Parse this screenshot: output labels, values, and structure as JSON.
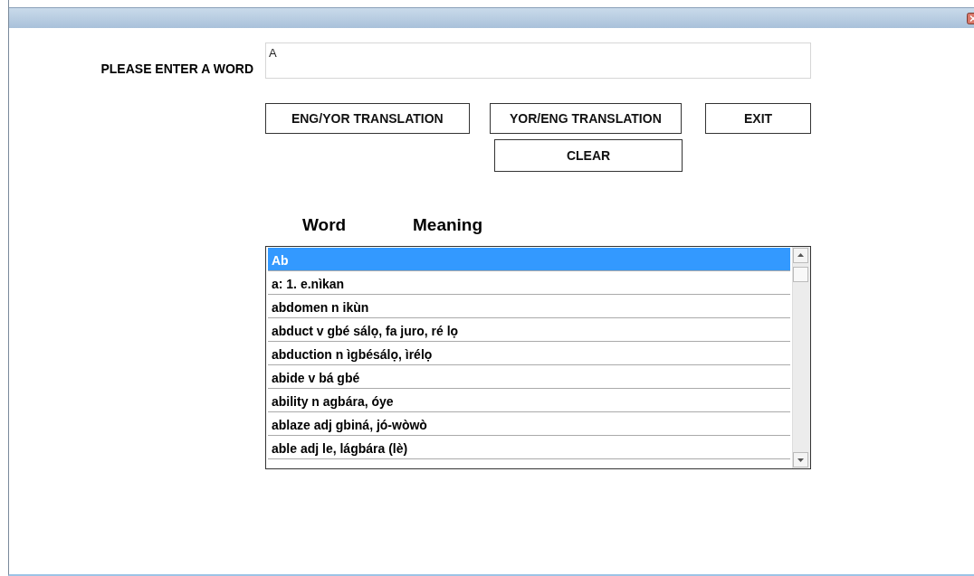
{
  "form": {
    "label": "PLEASE ENTER A WORD",
    "input_value": "A"
  },
  "buttons": [
    {
      "label": "ENG/YOR TRANSLATION",
      "kind": "eng"
    },
    {
      "label": "YOR/ENG TRANSLATION",
      "kind": "yor"
    },
    {
      "label": "EXIT",
      "kind": "exit"
    },
    {
      "label": "CLEAR",
      "kind": "clear"
    }
  ],
  "list_headers": [
    "Word",
    "Meaning"
  ],
  "list_items": [
    {
      "text": "Ab",
      "selected": true
    },
    {
      "text": "a: 1. e.nìkan",
      "selected": false
    },
    {
      "text": "abdomen n ikùn",
      "selected": false
    },
    {
      "text": "abduct v gbé sálọ, fa juro, ré lọ",
      "selected": false
    },
    {
      "text": "abduction n ìgbésálọ, ìrélọ",
      "selected": false
    },
    {
      "text": "abide v bá gbé",
      "selected": false
    },
    {
      "text": "ability n agbára, óye",
      "selected": false
    },
    {
      "text": "ablaze adj gbiná, jó-wòwò",
      "selected": false
    },
    {
      "text": "able adj le, lágbára (lè)",
      "selected": false
    }
  ]
}
